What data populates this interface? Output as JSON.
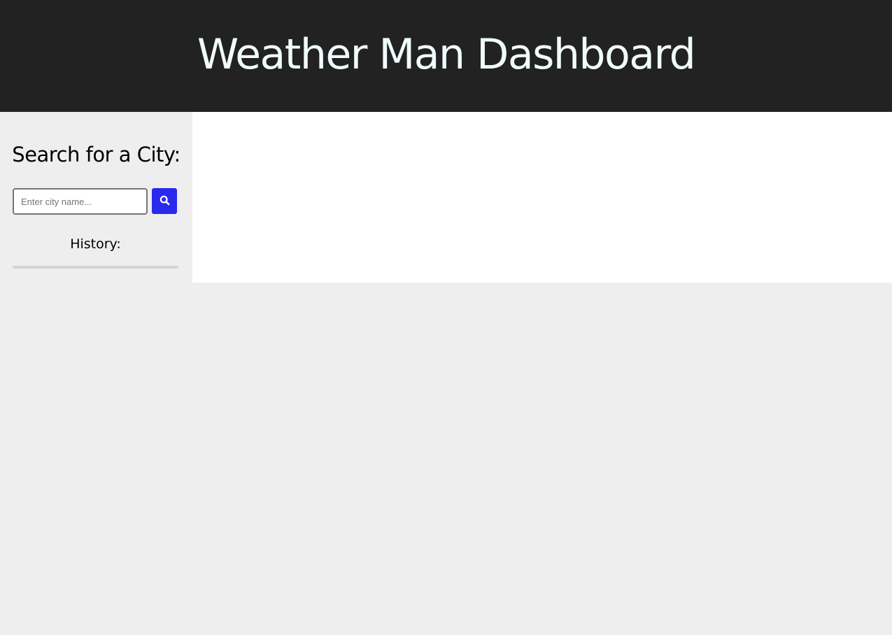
{
  "header": {
    "title": "Weather Man Dashboard"
  },
  "sidebar": {
    "heading": "Search for a City:",
    "search": {
      "placeholder": "Enter city name...",
      "value": "",
      "button_icon": "search-icon"
    },
    "history": {
      "label": "History:",
      "items": []
    }
  },
  "colors": {
    "header_bg": "#222222",
    "header_text": "#f0fbfb",
    "page_bg": "#eeeeee",
    "panel_bg": "#ffffff",
    "accent": "#2a2aee"
  }
}
